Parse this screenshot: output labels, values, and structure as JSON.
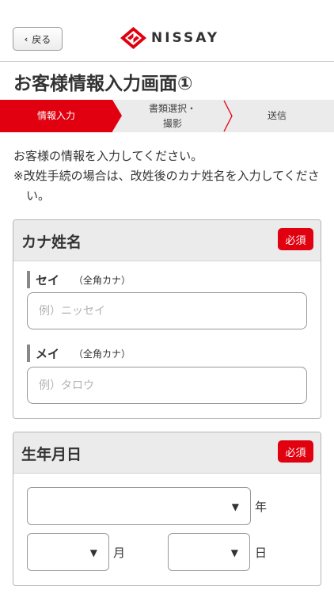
{
  "header": {
    "back_label": "戻る",
    "logo_text": "NISSAY",
    "logo_color": "#e0000f"
  },
  "page_title": "お客様情報入力画面①",
  "steps": [
    {
      "label": "情報入力",
      "active": true
    },
    {
      "label_line1": "書類選択・",
      "label_line2": "撮影",
      "active": false
    },
    {
      "label": "送信",
      "active": false
    }
  ],
  "intro": {
    "line1": "お客様の情報を入力してください。",
    "note": "※改姓手続の場合は、改姓後のカナ姓名を入力してください。"
  },
  "kana_card": {
    "title": "カナ姓名",
    "required": "必須",
    "sei": {
      "label": "セイ",
      "sub": "（全角カナ）",
      "value": "",
      "placeholder": "例）ニッセイ"
    },
    "mei": {
      "label": "メイ",
      "sub": "（全角カナ）",
      "value": "",
      "placeholder": "例）タロウ"
    }
  },
  "birth_card": {
    "title": "生年月日",
    "required": "必須",
    "year": {
      "value": "",
      "unit": "年"
    },
    "month": {
      "value": "",
      "unit": "月"
    },
    "day": {
      "value": "",
      "unit": "日"
    }
  },
  "icons": {
    "back": "chevron-left-icon",
    "select": "caret-down-icon",
    "logo": "nissay-logo-icon"
  },
  "colors": {
    "accent": "#e0000f",
    "panel": "#ebebeb",
    "text": "#333333"
  }
}
